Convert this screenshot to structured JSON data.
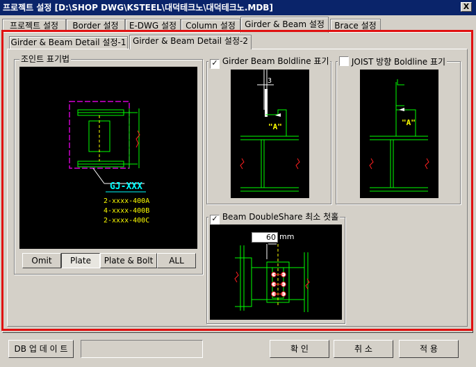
{
  "window": {
    "title": "프로젝트 설정  [D:\\SHOP DWG\\KSTEEL\\대덕테크노\\대덕테크노.MDB]",
    "close_label": "X"
  },
  "tabs": [
    {
      "label": "프로젝트 설정"
    },
    {
      "label": "Border 설정"
    },
    {
      "label": "E-DWG 설정"
    },
    {
      "label": "Column 설정"
    },
    {
      "label": "Girder & Beam 설정"
    },
    {
      "label": "Brace 설정"
    }
  ],
  "subtabs": [
    {
      "label": "Girder & Beam Detail 설정-1"
    },
    {
      "label": "Girder & Beam Detail 설정-2"
    }
  ],
  "joint": {
    "group_label": "조인트 표기법",
    "title": "GJ-XXX",
    "lines": [
      "2-xxxx-400A",
      "4-xxxx-400B",
      "2-xxxx-400C"
    ],
    "buttons": [
      "Omit",
      "Plate",
      "Plate & Bolt",
      "ALL"
    ],
    "selected": "Plate"
  },
  "girder_boldline": {
    "label": "Girder Beam Boldline 표기",
    "checked": true,
    "dim": "3",
    "mark": "\"A\""
  },
  "joist_boldline": {
    "label": "JOIST 방향 Boldline 표기",
    "checked": false,
    "mark": "\"A\""
  },
  "doubleshare": {
    "label": "Beam DoubleShare 최소 첫홀",
    "checked": true,
    "value": "60",
    "unit": "mm"
  },
  "footer": {
    "db_update": "DB 업 데 이 트",
    "status": "",
    "ok": "확    인",
    "cancel": "취    소",
    "apply": "적    용"
  },
  "colors": {
    "accent_red": "#e01010",
    "title_bar": "#0a246a",
    "drawing_bg": "#000000"
  }
}
